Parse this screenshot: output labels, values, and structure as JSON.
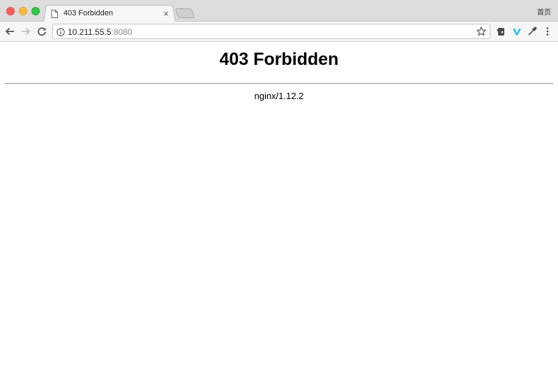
{
  "browser": {
    "tab": {
      "title": "403 Forbidden",
      "close_glyph": "×",
      "icon": "document-icon"
    },
    "profile_label": "首页",
    "toolbar": {
      "back_icon": "arrow-left-icon",
      "forward_icon": "arrow-right-icon",
      "reload_icon": "reload-icon"
    },
    "omnibox": {
      "host": "10.211.55.5",
      "port": ":8080",
      "info_icon": "info-icon",
      "bookmark_icon": "star-icon"
    },
    "extensions": [
      {
        "name": "evernote-icon"
      },
      {
        "name": "vimeo-icon"
      },
      {
        "name": "eyedropper-icon"
      },
      {
        "name": "menu-dots-icon"
      }
    ]
  },
  "page": {
    "heading": "403 Forbidden",
    "server_version": "nginx/1.12.2"
  },
  "colors": {
    "close": "#fc605c",
    "minimize": "#fdbc40",
    "maximize": "#34c84a",
    "vimeo": "#1ab7ea"
  }
}
